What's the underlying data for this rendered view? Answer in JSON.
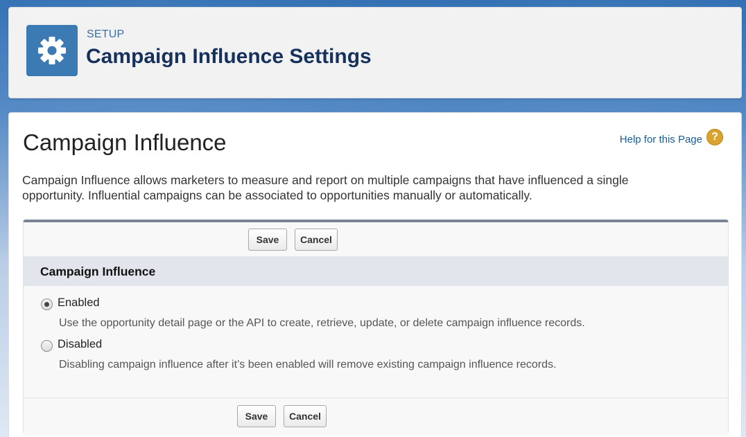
{
  "header": {
    "setup_label": "SETUP",
    "title": "Campaign Influence Settings",
    "icon": "gear-icon"
  },
  "page": {
    "title": "Campaign Influence",
    "help_link": "Help for this Page",
    "help_icon": "?",
    "description": "Campaign Influence allows marketers to measure and report on multiple campaigns that have influenced a single opportunity. Influential campaigns can be associated to opportunities manually or automatically."
  },
  "buttons": {
    "save_label": "Save",
    "cancel_label": "Cancel"
  },
  "section": {
    "title": "Campaign Influence",
    "options": [
      {
        "label": "Enabled",
        "help": "Use the opportunity detail page or the API to create, retrieve, update, or delete campaign influence records.",
        "checked": true
      },
      {
        "label": "Disabled",
        "help": "Disabling campaign influence after it’s been enabled will remove existing campaign influence records.",
        "checked": false
      }
    ]
  },
  "colors": {
    "brand_blue": "#3b7ab3",
    "title_navy": "#16325c",
    "link_blue": "#1a5c96",
    "help_orange": "#d9a330"
  }
}
